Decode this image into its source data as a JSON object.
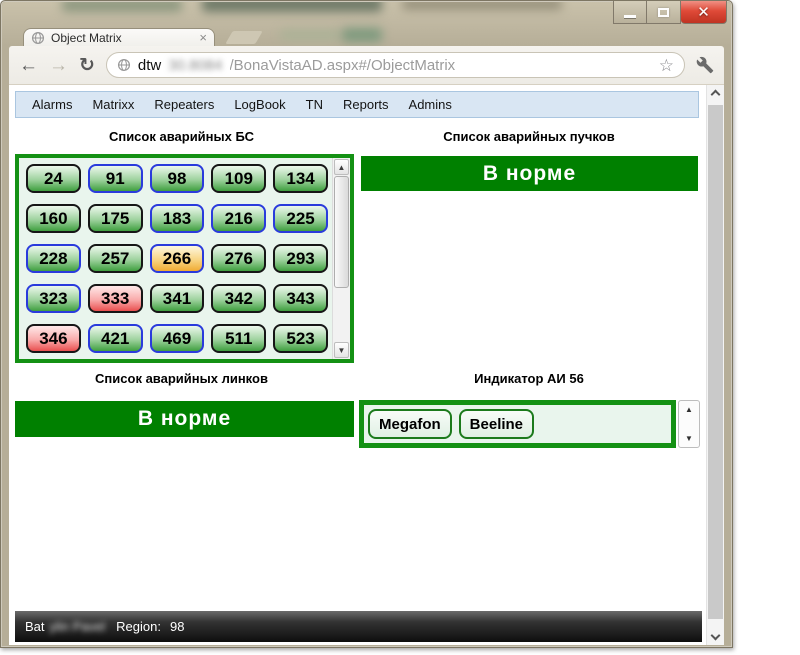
{
  "window_controls": {
    "minimize": "minimize",
    "maximize": "maximize",
    "close_glyph": "✕"
  },
  "tab": {
    "title": "Object Matrix",
    "close_glyph": "×"
  },
  "toolbar": {
    "back_glyph": "←",
    "forward_glyph": "→",
    "reload_glyph": "↻",
    "url_prefix": "dtw",
    "url_redacted": "30.8084",
    "url_suffix": "/BonaVistaAD.aspx#/ObjectMatrix",
    "star_glyph": "☆"
  },
  "menu": {
    "items": [
      "Alarms",
      "Matrixx",
      "Repeaters",
      "LogBook",
      "TN",
      "Reports",
      "Admins"
    ]
  },
  "headings": {
    "bs": "Список аварийных БС",
    "beams": "Список аварийных пучков",
    "links": "Список аварийных линков",
    "indicator": "Индикатор АИ 56"
  },
  "status_labels": {
    "beams_ok": "В норме",
    "links_ok": "В норме"
  },
  "bs_grid": {
    "cells": [
      {
        "label": "24",
        "color": "green",
        "ring": "black"
      },
      {
        "label": "91",
        "color": "green",
        "ring": "blue"
      },
      {
        "label": "98",
        "color": "green",
        "ring": "blue"
      },
      {
        "label": "109",
        "color": "green",
        "ring": "black"
      },
      {
        "label": "134",
        "color": "green",
        "ring": "black"
      },
      {
        "label": "160",
        "color": "green",
        "ring": "black"
      },
      {
        "label": "175",
        "color": "green",
        "ring": "black"
      },
      {
        "label": "183",
        "color": "green",
        "ring": "blue"
      },
      {
        "label": "216",
        "color": "green",
        "ring": "blue"
      },
      {
        "label": "225",
        "color": "green",
        "ring": "blue"
      },
      {
        "label": "228",
        "color": "green",
        "ring": "blue"
      },
      {
        "label": "257",
        "color": "green",
        "ring": "black"
      },
      {
        "label": "266",
        "color": "orange",
        "ring": "blue"
      },
      {
        "label": "276",
        "color": "green",
        "ring": "black"
      },
      {
        "label": "293",
        "color": "green",
        "ring": "black"
      },
      {
        "label": "323",
        "color": "green",
        "ring": "blue"
      },
      {
        "label": "333",
        "color": "red",
        "ring": "black"
      },
      {
        "label": "341",
        "color": "green",
        "ring": "black"
      },
      {
        "label": "342",
        "color": "green",
        "ring": "black"
      },
      {
        "label": "343",
        "color": "green",
        "ring": "black"
      },
      {
        "label": "346",
        "color": "red",
        "ring": "black"
      },
      {
        "label": "421",
        "color": "green",
        "ring": "blue"
      },
      {
        "label": "469",
        "color": "green",
        "ring": "blue"
      },
      {
        "label": "511",
        "color": "green",
        "ring": "black"
      },
      {
        "label": "523",
        "color": "green",
        "ring": "black"
      }
    ]
  },
  "indicator": {
    "buttons": [
      "Megafon",
      "Beeline"
    ]
  },
  "status_bar": {
    "user_prefix": "Bat",
    "user_redacted": "ylin Pavel",
    "region_label": "Region:",
    "region_value": "98"
  },
  "colors": {
    "ok_green": "#008000",
    "panel_border_green": "#149114",
    "cell_green": "#3f9f3f",
    "alarm_red": "#e94f4f",
    "warn_orange": "#f0ab33",
    "ring_blue": "#2a3bdc",
    "menubar_blue": "#d9e6f3",
    "statusbar_dark": "#0e0e0e"
  }
}
